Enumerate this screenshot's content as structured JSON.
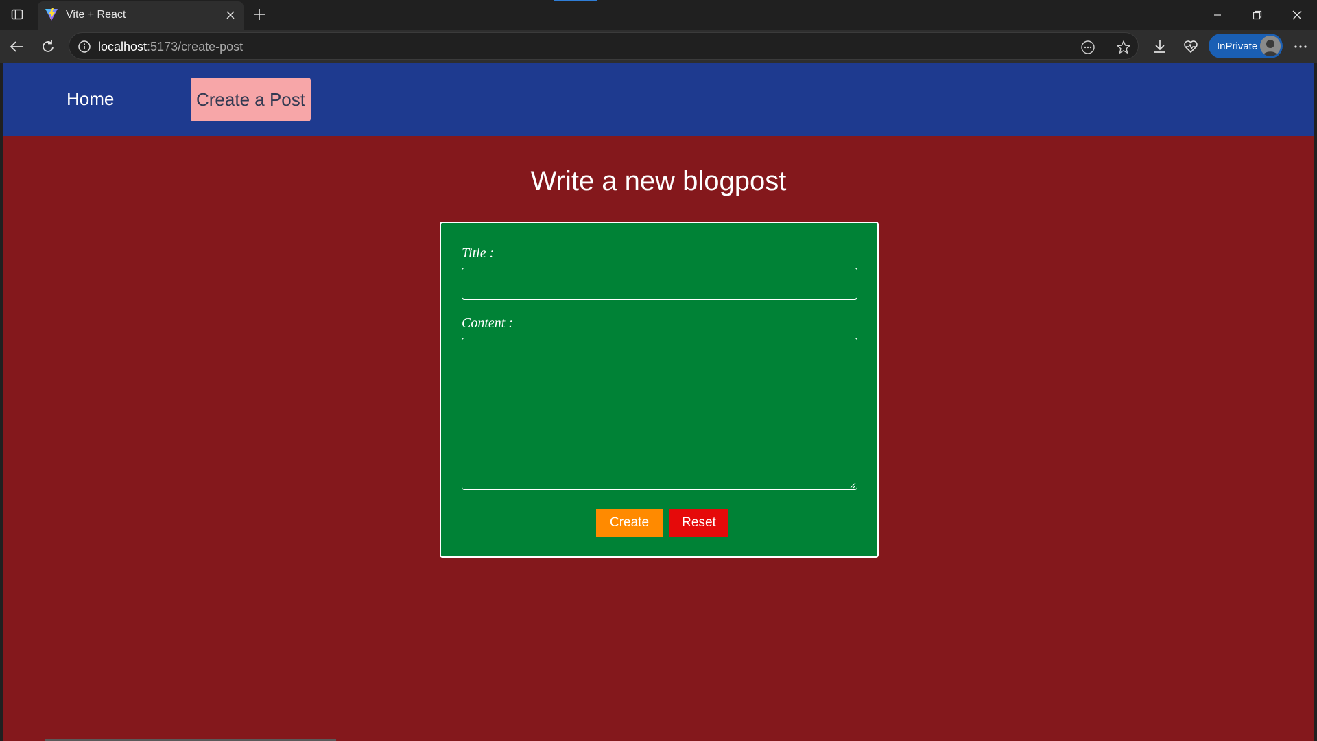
{
  "browser": {
    "tab": {
      "title": "Vite + React",
      "favicon": "vite-icon"
    },
    "address": {
      "host": "localhost",
      "path": ":5173/create-post"
    },
    "profile_label": "InPrivate",
    "accent_color": "#1a5fb4"
  },
  "page": {
    "nav": {
      "home_label": "Home",
      "create_label": "Create a Post"
    },
    "title": "Write a new blogpost",
    "form": {
      "title_label": "Title :",
      "title_value": "",
      "content_label": "Content :",
      "content_value": "",
      "create_label": "Create",
      "reset_label": "Reset"
    },
    "colors": {
      "background": "#84181c",
      "navbar": "#1e3a8f",
      "active_nav": "#f7a6a8",
      "form_card": "#008236",
      "create_button": "#ff8a00",
      "reset_button": "#e50a0a"
    }
  }
}
